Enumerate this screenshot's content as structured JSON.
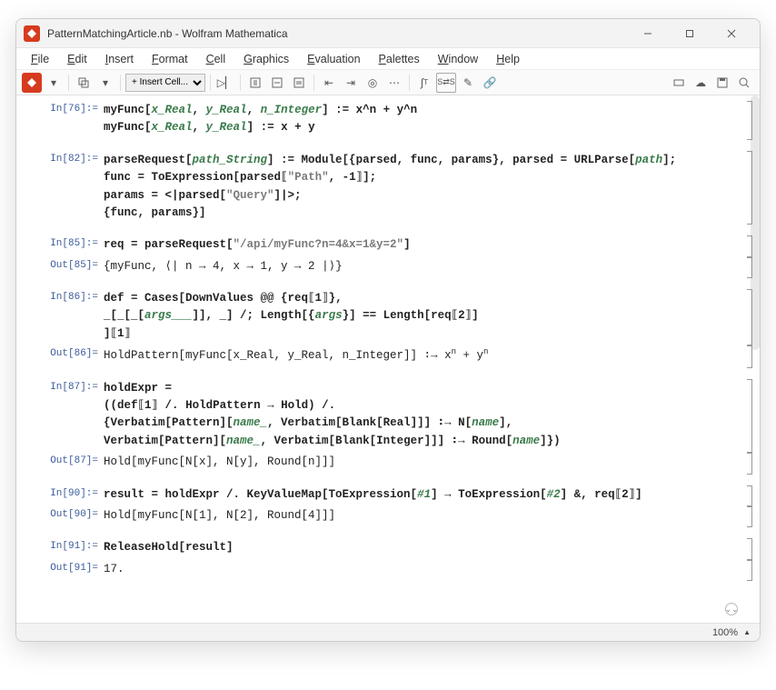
{
  "window": {
    "title": "PatternMatchingArticle.nb - Wolfram Mathematica"
  },
  "menu": [
    "File",
    "Edit",
    "Insert",
    "Format",
    "Cell",
    "Graphics",
    "Evaluation",
    "Palettes",
    "Window",
    "Help"
  ],
  "toolbar": {
    "insert_cell": "Insert Cell..."
  },
  "labels": {
    "in76": "In[76]:=",
    "in82": "In[82]:=",
    "in85": "In[85]:=",
    "out85": "Out[85]=",
    "in86": "In[86]:=",
    "out86": "Out[86]=",
    "in87": "In[87]:=",
    "out87": "Out[87]=",
    "in90": "In[90]:=",
    "out90": "Out[90]=",
    "in91": "In[91]:=",
    "out91": "Out[91]="
  },
  "code": {
    "in76a_p1": "myFunc[",
    "in76a_p2": "x_Real",
    "in76a_p3": ", ",
    "in76a_p4": "y_Real",
    "in76a_p5": ", ",
    "in76a_p6": "n_Integer",
    "in76a_p7": "] := x^n + y^n",
    "in76b_p1": "myFunc[",
    "in76b_p2": "x_Real",
    "in76b_p3": ", ",
    "in76b_p4": "y_Real",
    "in76b_p5": "] := x + y",
    "in82a_p1": "parseRequest[",
    "in82a_p2": "path_String",
    "in82a_p3": "] := Module[{parsed, func, params}, parsed = URLParse[",
    "in82a_p4": "path",
    "in82a_p5": "];",
    "in82b_p1": "  func = ToExpression[parsed⟦",
    "in82b_p2": "\"Path\"",
    "in82b_p3": ", -1⟧];",
    "in82c_p1": "  params = <|parsed[",
    "in82c_p2": "\"Query\"",
    "in82c_p3": "]|>;",
    "in82d": "  {func, params}]",
    "in85_p1": "req = parseRequest[",
    "in85_p2": "\"/api/myFunc?n=4&x=1&y=2\"",
    "in85_p3": "]",
    "out85": "{myFunc, ⟨| n → 4, x → 1, y → 2 |⟩}",
    "in86a": "def = Cases[DownValues @@ {req⟦1⟧},",
    "in86b_p1": "    _[_[_[",
    "in86b_p2": "args___",
    "in86b_p3": "]], _] /; Length[{",
    "in86b_p4": "args",
    "in86b_p5": "}] == Length[req⟦2⟧]",
    "in86c": "  ]⟦1⟧",
    "out86_p1": "HoldPattern[myFunc[x_Real, y_Real, n_Integer]] ∶→ x",
    "out86_p2": "n",
    "out86_p3": " + y",
    "out86_p4": "n",
    "in87a": "holdExpr =",
    "in87b": " ((def⟦1⟧ /. HoldPattern → Hold) /.",
    "in87c_p1": "   {Verbatim[Pattern][",
    "in87c_p2": "name_",
    "in87c_p3": ", Verbatim[Blank[Real]]] ∶→ N[",
    "in87c_p4": "name",
    "in87c_p5": "],",
    "in87d_p1": "    Verbatim[Pattern][",
    "in87d_p2": "name_",
    "in87d_p3": ", Verbatim[Blank[Integer]]] ∶→ Round[",
    "in87d_p4": "name",
    "in87d_p5": "]})",
    "out87": "Hold[myFunc[N[x], N[y], Round[n]]]",
    "in90_p1": "result = holdExpr /. KeyValueMap[ToExpression[",
    "in90_p2": "#1",
    "in90_p3": "] → ToExpression[",
    "in90_p4": "#2",
    "in90_p5": "] &, req⟦2⟧]",
    "out90": "Hold[myFunc[N[1], N[2], Round[4]]]",
    "in91": "ReleaseHold[result]",
    "out91": "17."
  },
  "status": {
    "zoom": "100%"
  }
}
